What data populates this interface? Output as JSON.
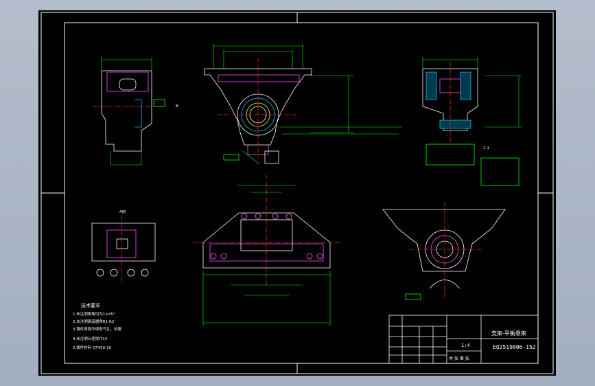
{
  "title_block": {
    "part_name": "支架-平衡悬架",
    "drawing_number": "EQ2519006-152",
    "scale": "1:4",
    "sheet_info": "共 张 第 张"
  },
  "tech_requirements": {
    "heading": "技术要求",
    "items": [
      "1.未注明倒角均为1×45°",
      "2.未注明铸造圆角R1-R2",
      "3.铸件表面不得有气孔、砂眼",
      "4.未注明公差按IT14",
      "5.铸件材料 QT450-10"
    ]
  },
  "view_labels": {
    "top_view": "A向",
    "section_label": "1-1",
    "section_arrow": "B"
  },
  "colors": {
    "outline": "#ffffff",
    "dimension": "#00ff00",
    "center": "#ff2a2a",
    "section": "#ff55ff",
    "hidden": "#ffff00",
    "hatch": "#00c8ff"
  }
}
